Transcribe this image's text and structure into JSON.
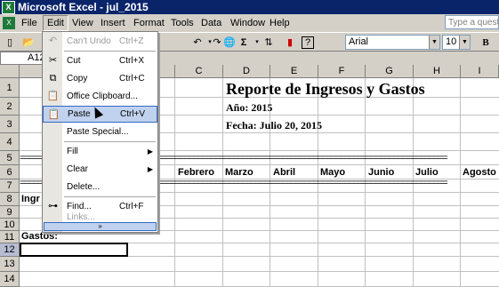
{
  "window": {
    "title": "Microsoft Excel - jul_2015",
    "app_icon": "excel-icon"
  },
  "menubar": {
    "items": [
      "File",
      "Edit",
      "View",
      "Insert",
      "Format",
      "Tools",
      "Data",
      "Window",
      "Help"
    ],
    "help_placeholder": "Type a questio"
  },
  "toolbar": {
    "font": "Arial",
    "size": "10",
    "bold": "B",
    "icons": [
      "new-icon",
      "open-icon",
      "undo-icon",
      "redo-icon",
      "hyperlink-icon",
      "autosum-icon",
      "sort-icon",
      "chart-icon",
      "help-icon"
    ]
  },
  "formula": {
    "namebox": "A12"
  },
  "grid": {
    "columns": [
      "C",
      "D",
      "E",
      "F",
      "G",
      "H",
      "I"
    ],
    "rows": [
      "1",
      "2",
      "3",
      "4",
      "5",
      "6",
      "7",
      "8",
      "9",
      "10",
      "11",
      "12",
      "13",
      "14"
    ],
    "title": "Reporte de Ingresos y Gastos",
    "year": "Año: 2015",
    "date": "Fecha: Julio 20, 2015",
    "months": [
      "Febrero",
      "Marzo",
      "Abril",
      "Mayo",
      "Junio",
      "Julio",
      "Agosto"
    ],
    "ingresos_partial": "Ingr",
    "gastos": "Gastos:",
    "separator": "================================================================================================"
  },
  "edit_menu": {
    "items": [
      {
        "label": "Can't Undo",
        "shortcut": "Ctrl+Z",
        "icon": "undo-icon",
        "disabled": true
      },
      {
        "label": "Cut",
        "shortcut": "Ctrl+X",
        "icon": "scissors-icon"
      },
      {
        "label": "Copy",
        "shortcut": "Ctrl+C",
        "icon": "copy-icon"
      },
      {
        "label": "Office Clipboard...",
        "shortcut": "",
        "icon": "clipboard-icon"
      },
      {
        "label": "Paste",
        "shortcut": "Ctrl+V",
        "icon": "paste-icon",
        "highlighted": true
      },
      {
        "label": "Paste Special...",
        "shortcut": ""
      },
      {
        "label": "Fill",
        "shortcut": "",
        "submenu": true
      },
      {
        "label": "Clear",
        "shortcut": "",
        "submenu": true
      },
      {
        "label": "Delete...",
        "shortcut": ""
      },
      {
        "label": "Find...",
        "shortcut": "Ctrl+F",
        "icon": "binoculars-icon"
      },
      {
        "label": "Links...",
        "shortcut": "",
        "disabled": true
      }
    ],
    "expand": "»"
  }
}
